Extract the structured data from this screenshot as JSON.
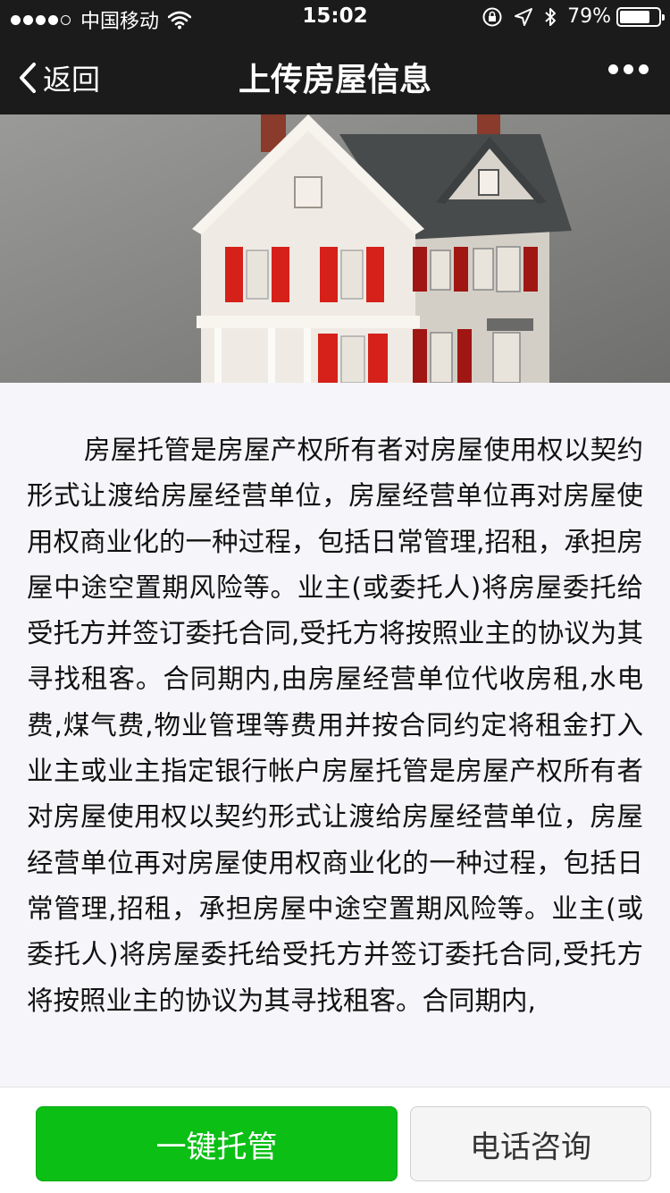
{
  "status_bar": {
    "carrier": "中国移动",
    "time": "15:02",
    "battery_percent": "79%",
    "battery_level": 0.79
  },
  "nav": {
    "back_label": "返回",
    "title": "上传房屋信息"
  },
  "hero_image": {
    "subject": "model-house",
    "colors": {
      "walls": "#eeeae3",
      "shutters": "#d6201a",
      "roof": "#4a4d4e",
      "background": "#8a8a8a"
    }
  },
  "article": {
    "text": "房屋托管是房屋产权所有者对房屋使用权以契约形式让渡给房屋经营单位，房屋经营单位再对房屋使用权商业化的一种过程，包括日常管理,招租，承担房屋中途空置期风险等。业主(或委托人)将房屋委托给受托方并签订委托合同,受托方将按照业主的协议为其寻找租客。合同期内,由房屋经营单位代收房租,水电费,煤气费,物业管理等费用并按合同约定将租金打入业主或业主指定银行帐户房屋托管是房屋产权所有者对房屋使用权以契约形式让渡给房屋经营单位，房屋经营单位再对房屋使用权商业化的一种过程，包括日常管理,招租，承担房屋中途空置期风险等。业主(或委托人)将房屋委托给受托方并签订委托合同,受托方将按照业主的协议为其寻找租客。合同期内,"
  },
  "footer": {
    "primary_label": "一键托管",
    "secondary_label": "电话咨询",
    "primary_color": "#0bbf15"
  }
}
